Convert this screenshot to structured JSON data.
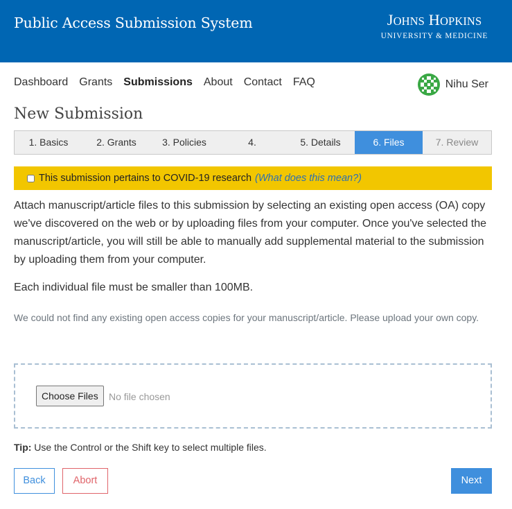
{
  "header": {
    "app_title": "Public Access Submission System",
    "logo_main": "Johns Hopkins",
    "logo_sub": "UNIVERSITY & MEDICINE",
    "bg_color": "#0066b3"
  },
  "nav": {
    "items": [
      {
        "label": "Dashboard"
      },
      {
        "label": "Grants"
      },
      {
        "label": "Submissions",
        "active": true
      },
      {
        "label": "About"
      },
      {
        "label": "Contact"
      },
      {
        "label": "FAQ"
      }
    ]
  },
  "user": {
    "name": "Nihu Ser",
    "avatar_icon": "identicon-avatar",
    "avatar_color": "#3aa845"
  },
  "page": {
    "title": "New Submission"
  },
  "steps": [
    {
      "label": "1. Basics",
      "state": "done"
    },
    {
      "label": "2. Grants",
      "state": "done"
    },
    {
      "label": "3. Policies",
      "state": "done"
    },
    {
      "label": "4.",
      "state": "done"
    },
    {
      "label": "5. Details",
      "state": "done"
    },
    {
      "label": "6. Files",
      "state": "active"
    },
    {
      "label": "7. Review",
      "state": "future"
    }
  ],
  "covid": {
    "label": "This submission pertains to COVID-19 research",
    "help_link": "(What does this mean?)",
    "checked": false,
    "bg_color": "#f2c600"
  },
  "content": {
    "intro": "Attach manuscript/article files to this submission by selecting an existing open access (OA) copy we've discovered on the web or by uploading files from your computer. Once you've selected the manuscript/article, you will still be able to manually add supplemental material to the submission by uploading them from your computer.",
    "size_note": "Each individual file must be smaller than 100MB.",
    "not_found": "We could not find any existing open access copies for your manuscript/article. Please upload your own copy."
  },
  "upload": {
    "button_label": "Choose Files",
    "status": "No file chosen"
  },
  "tip": {
    "label": "Tip:",
    "text": " Use the Control or the Shift key to select multiple files."
  },
  "buttons": {
    "back": "Back",
    "abort": "Abort",
    "next": "Next"
  },
  "colors": {
    "accent": "#3f8fdd",
    "danger": "#e0646a"
  }
}
